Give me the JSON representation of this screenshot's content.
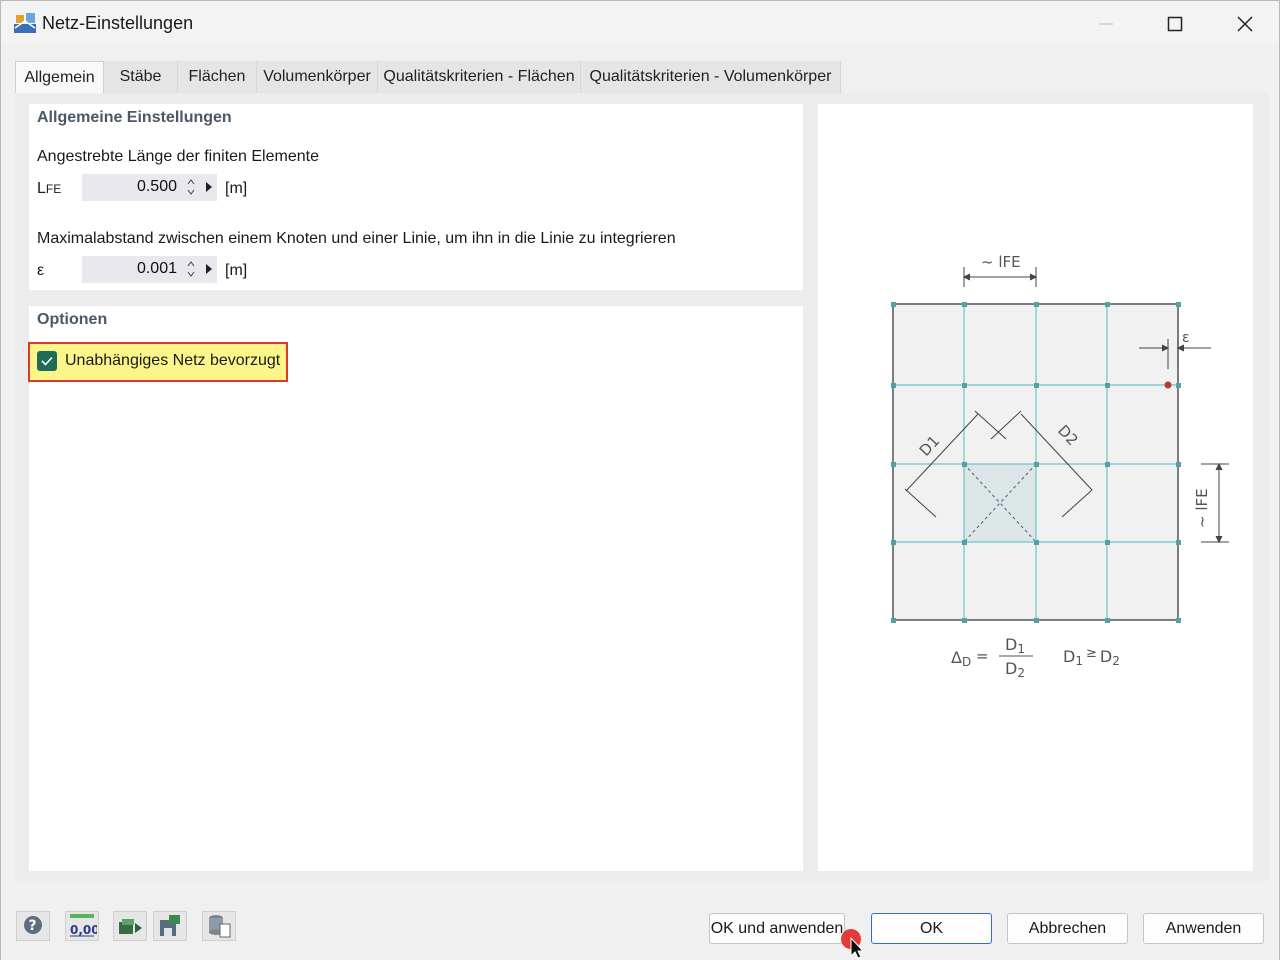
{
  "window": {
    "title": "Netz-Einstellungen",
    "controls": {
      "minimize": "minimize-icon",
      "maximize": "maximize-icon",
      "close": "close-icon"
    }
  },
  "tabs": [
    {
      "label": "Allgemein",
      "active": true
    },
    {
      "label": "Stäbe",
      "active": false
    },
    {
      "label": "Flächen",
      "active": false
    },
    {
      "label": "Volumenkörper",
      "active": false
    },
    {
      "label": "Qualitätskriterien - Flächen",
      "active": false
    },
    {
      "label": "Qualitätskriterien - Volumenkörper",
      "active": false
    }
  ],
  "general": {
    "title": "Allgemeine Einstellungen",
    "fe_length": {
      "description": "Angestrebte Länge der finiten Elemente",
      "symbol": "L",
      "symbol_sub": "FE",
      "value": "0.500",
      "unit": "[m]"
    },
    "max_distance": {
      "description": "Maximalabstand zwischen einem Knoten und einer Linie, um ihn in die Linie zu integrieren",
      "symbol": "ε",
      "value": "0.001",
      "unit": "[m]"
    }
  },
  "options": {
    "title": "Optionen",
    "independent_mesh": {
      "label": "Unabhängiges Netz bevorzugt",
      "checked": true
    }
  },
  "diagram": {
    "lfe_top": "~ l",
    "lfe_top_sub": "FE",
    "epsilon": "ε",
    "d1": "D1",
    "d2": "D2",
    "lfe_right": "~ l",
    "lfe_right_sub": "FE",
    "delta": "Δ",
    "delta_sub": "D",
    "eq": "=",
    "frac_num": "D",
    "frac_num_sub": "1",
    "frac_den": "D",
    "frac_den_sub": "2",
    "cond_a": "D",
    "cond_a_sub": "1",
    "cond_op": "≥",
    "cond_b": "D",
    "cond_b_sub": "2"
  },
  "footer": {
    "icons": [
      "help-icon",
      "units-icon",
      "load-settings-icon",
      "save-settings-icon",
      "database-icon"
    ],
    "units_text": "0,00",
    "buttons": {
      "ok_apply": "OK und anwenden",
      "ok": "OK",
      "cancel": "Abbrechen",
      "apply": "Anwenden"
    }
  },
  "colors": {
    "accent_check": "#1e6b57",
    "highlight_fill": "#fcf58a",
    "highlight_border": "#e2352b",
    "mesh_line": "#6cc4cc",
    "node": "#4fa3a8",
    "ok_border": "#2e6fd1"
  }
}
